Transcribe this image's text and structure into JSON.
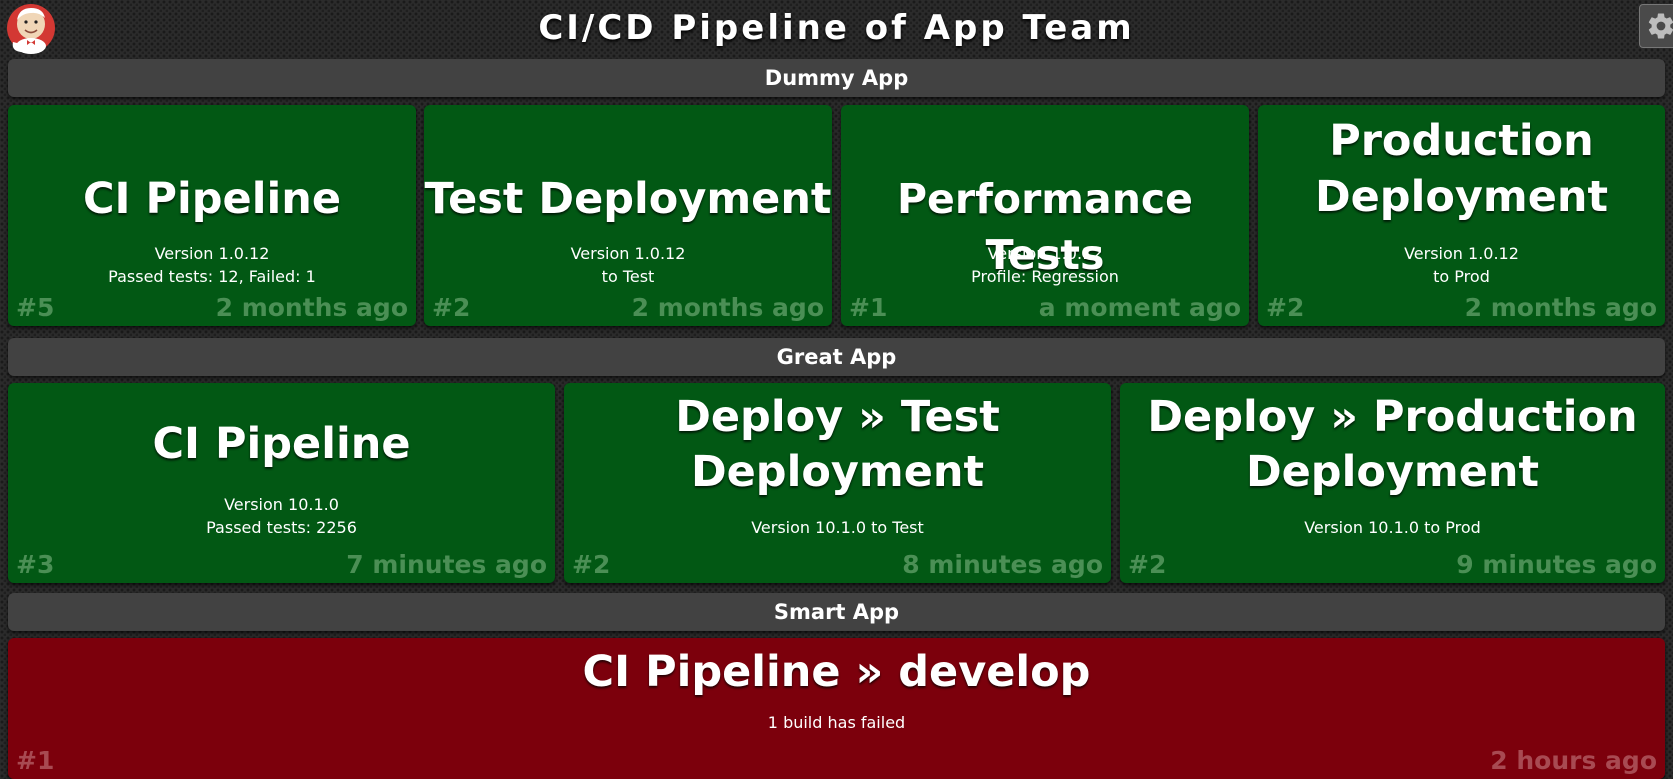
{
  "header": {
    "title": "CI/CD Pipeline of App Team",
    "logo_icon": "jenkins-butler-icon",
    "settings_icon": "gear-icon"
  },
  "colors": {
    "success": "#025814",
    "failure": "#7c000c",
    "section_bar": "#424242"
  },
  "sections": [
    {
      "name": "Dummy App",
      "jobs": [
        {
          "title": "CI Pipeline",
          "details": [
            "Version 1.0.12",
            "Passed tests: 12, Failed: 1"
          ],
          "build": "#5",
          "time": "2 months ago",
          "status": "success"
        },
        {
          "title": "Test Deployment",
          "details": [
            "Version 1.0.12",
            "to Test"
          ],
          "build": "#2",
          "time": "2 months ago",
          "status": "success"
        },
        {
          "title": "Performance Tests",
          "details": [
            "Version 1.0.12",
            "Profile: Regression"
          ],
          "build": "#1",
          "time": "a moment ago",
          "status": "success"
        },
        {
          "title": "Production Deployment",
          "title_lines": [
            "Production",
            "Deployment"
          ],
          "details": [
            "Version 1.0.12",
            "to Prod"
          ],
          "build": "#2",
          "time": "2 months ago",
          "status": "success"
        }
      ]
    },
    {
      "name": "Great App",
      "jobs": [
        {
          "title": "CI Pipeline",
          "details": [
            "Version 10.1.0",
            "Passed tests: 2256"
          ],
          "build": "#3",
          "time": "7 minutes ago",
          "status": "success"
        },
        {
          "title": "Deploy » Test Deployment",
          "title_lines": [
            "Deploy » Test",
            "Deployment"
          ],
          "details": [
            "Version 10.1.0 to Test"
          ],
          "build": "#2",
          "time": "8 minutes ago",
          "status": "success"
        },
        {
          "title": "Deploy » Production Deployment",
          "title_lines": [
            "Deploy » Production",
            "Deployment"
          ],
          "details": [
            "Version 10.1.0 to Prod"
          ],
          "build": "#2",
          "time": "9 minutes ago",
          "status": "success"
        }
      ]
    },
    {
      "name": "Smart App",
      "jobs": [
        {
          "title": "CI Pipeline » develop",
          "details": [
            "1 build has failed"
          ],
          "build": "#1",
          "time": "2 hours ago",
          "status": "failure"
        }
      ]
    }
  ]
}
